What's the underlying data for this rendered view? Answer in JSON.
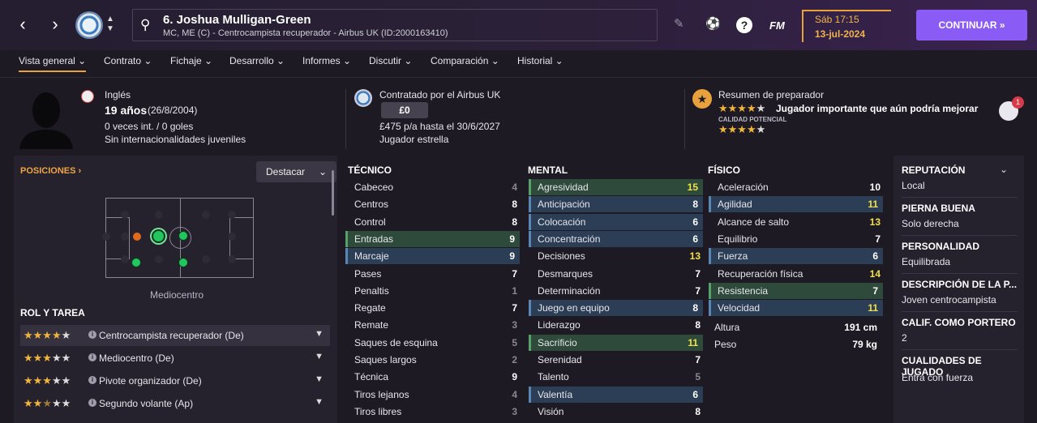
{
  "header": {
    "player_name": "6. Joshua Mulligan-Green",
    "player_sub": "MC, ME (C) - Centrocampista recuperador - Airbus UK (ID:2000163410)",
    "date_day": "Sáb 17:15",
    "date": "13-jul-2024",
    "continue_label": "CONTINUAR",
    "fm_label": "FM",
    "notif_count": "1"
  },
  "tabs": [
    {
      "label": "Vista general"
    },
    {
      "label": "Contrato"
    },
    {
      "label": "Fichaje"
    },
    {
      "label": "Desarrollo"
    },
    {
      "label": "Informes"
    },
    {
      "label": "Discutir"
    },
    {
      "label": "Comparación"
    },
    {
      "label": "Historial"
    }
  ],
  "info": {
    "nationality": "Inglés",
    "age": "19 años",
    "dob": "(26/8/2004)",
    "caps": "0 veces int. / 0 goles",
    "youth_caps": "Sin internacionalidades juveniles",
    "contract_club": "Contratado por el Airbus UK",
    "value": "£0",
    "wage": "£475 p/a hasta el 30/6/2027",
    "status": "Jugador estrella",
    "coach_title": "Resumen de preparador",
    "coach_summary": "Jugador importante que aún podría mejorar",
    "potential_label": "CALIDAD POTENCIAL",
    "current_stars": 4,
    "potential_stars": 4.5
  },
  "positions": {
    "title": "POSICIONES",
    "highlight_label": "Destacar",
    "position_label": "Mediocentro",
    "roles_title": "ROL Y TAREA",
    "roles": [
      {
        "label": "Centrocampista recuperador (De)",
        "stars": 4
      },
      {
        "label": "Mediocentro (De)",
        "stars": 3
      },
      {
        "label": "Pivote organizador (De)",
        "stars": 3
      },
      {
        "label": "Segundo volante (Ap)",
        "stars": 2.5
      }
    ]
  },
  "attributes": {
    "tecnico_title": "TÉCNICO",
    "mental_title": "MENTAL",
    "fisico_title": "FÍSICO",
    "tecnico": [
      {
        "name": "Cabeceo",
        "value": "4"
      },
      {
        "name": "Centros",
        "value": "8"
      },
      {
        "name": "Control",
        "value": "8"
      },
      {
        "name": "Entradas",
        "value": "9"
      },
      {
        "name": "Marcaje",
        "value": "9"
      },
      {
        "name": "Pases",
        "value": "7"
      },
      {
        "name": "Penaltis",
        "value": "1"
      },
      {
        "name": "Regate",
        "value": "7"
      },
      {
        "name": "Remate",
        "value": "3"
      },
      {
        "name": "Saques de esquina",
        "value": "5"
      },
      {
        "name": "Saques largos",
        "value": "2"
      },
      {
        "name": "Técnica",
        "value": "9"
      },
      {
        "name": "Tiros lejanos",
        "value": "4"
      },
      {
        "name": "Tiros libres",
        "value": "3"
      }
    ],
    "mental": [
      {
        "name": "Agresividad",
        "value": "15"
      },
      {
        "name": "Anticipación",
        "value": "8"
      },
      {
        "name": "Colocación",
        "value": "6"
      },
      {
        "name": "Concentración",
        "value": "6"
      },
      {
        "name": "Decisiones",
        "value": "13"
      },
      {
        "name": "Desmarques",
        "value": "7"
      },
      {
        "name": "Determinación",
        "value": "7"
      },
      {
        "name": "Juego en equipo",
        "value": "8"
      },
      {
        "name": "Liderazgo",
        "value": "8"
      },
      {
        "name": "Sacrificio",
        "value": "11"
      },
      {
        "name": "Serenidad",
        "value": "7"
      },
      {
        "name": "Talento",
        "value": "5"
      },
      {
        "name": "Valentía",
        "value": "6"
      },
      {
        "name": "Visión",
        "value": "8"
      }
    ],
    "fisico": [
      {
        "name": "Aceleración",
        "value": "10"
      },
      {
        "name": "Agilidad",
        "value": "11"
      },
      {
        "name": "Alcance de salto",
        "value": "13"
      },
      {
        "name": "Equilibrio",
        "value": "7"
      },
      {
        "name": "Fuerza",
        "value": "6"
      },
      {
        "name": "Recuperación física",
        "value": "14"
      },
      {
        "name": "Resistencia",
        "value": "7"
      },
      {
        "name": "Velocidad",
        "value": "11"
      }
    ],
    "height_label": "Altura",
    "height": "191 cm",
    "weight_label": "Peso",
    "weight": "79 kg"
  },
  "side": [
    {
      "title": "REPUTACIÓN",
      "value": "Local"
    },
    {
      "title": "PIERNA BUENA",
      "value": "Solo derecha"
    },
    {
      "title": "PERSONALIDAD",
      "value": "Equilibrada"
    },
    {
      "title": "DESCRIPCIÓN DE LA P...",
      "value": "Joven centrocampista"
    },
    {
      "title": "CALIF. COMO PORTERO",
      "value": "2"
    },
    {
      "title": "CUALIDADES DE JUGADO",
      "value": "Entra con fuerza"
    }
  ],
  "colors": {
    "accent": "#8a5cf5",
    "orange": "#e8a13c",
    "green_bg": "#2e4a3a",
    "blue_bg": "#2c3e55"
  }
}
